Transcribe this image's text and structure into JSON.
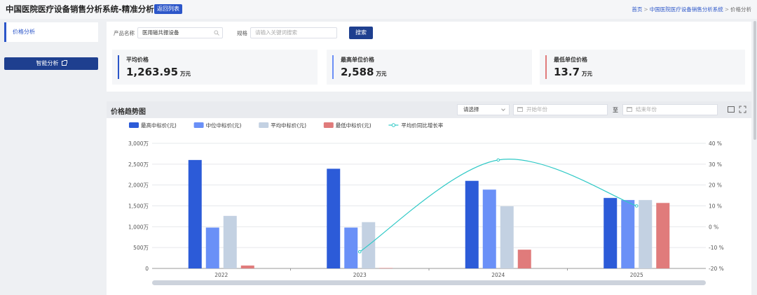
{
  "header": {
    "title": "中国医院医疗设备销售分析系统-精准分析",
    "back_label": "返回列表",
    "breadcrumb": [
      "首页",
      "中国医院医疗设备销售分析系统",
      "价格分析"
    ]
  },
  "sidebar": {
    "items": [
      {
        "label": "价格分析"
      }
    ],
    "smart_button": "智能分析"
  },
  "filter": {
    "product_label": "产品名称",
    "product_value": "医用磁共振设备",
    "spec_label": "规格",
    "spec_placeholder": "请输入关键词搜索",
    "search_button": "搜索"
  },
  "stats": [
    {
      "label": "平均价格",
      "value": "1,263.95",
      "unit": "万元",
      "color": "#2c56c9"
    },
    {
      "label": "最高单位价格",
      "value": "2,588",
      "unit": "万元",
      "color": "#6b8ef5"
    },
    {
      "label": "最低单位价格",
      "value": "13.7",
      "unit": "万元",
      "color": "#e07b7b"
    }
  ],
  "chart_panel": {
    "title": "价格趋势图",
    "select_value": "请选择",
    "start_placeholder": "开始年份",
    "to_label": "至",
    "end_placeholder": "结束年份"
  },
  "chart_data": {
    "type": "bar",
    "categories": [
      "2022",
      "2023",
      "2024",
      "2025"
    ],
    "series": [
      {
        "name": "最高中标价(元)",
        "color": "#2c5bd8",
        "values": [
          2600,
          2390,
          2100,
          1690
        ]
      },
      {
        "name": "中位中标价(元)",
        "color": "#6a90f7",
        "values": [
          980,
          980,
          1890,
          1640
        ]
      },
      {
        "name": "平均中标价(元)",
        "color": "#c3d1e2",
        "values": [
          1260,
          1110,
          1490,
          1640
        ]
      },
      {
        "name": "最低中标价(元)",
        "color": "#e07b7b",
        "values": [
          70,
          10,
          450,
          1570
        ]
      }
    ],
    "line_series": {
      "name": "平均价同比增长率",
      "color": "#2fc9c6",
      "values": [
        null,
        -12,
        32,
        10
      ]
    },
    "y_left": {
      "min": 0,
      "max": 3000,
      "ticks": [
        "0",
        "500万",
        "1,000万",
        "1,500万",
        "2,000万",
        "2,500万",
        "3,000万"
      ]
    },
    "y_right": {
      "min": -20,
      "max": 40,
      "ticks": [
        "-20 %",
        "-10 %",
        "0 %",
        "10 %",
        "20 %",
        "30 %",
        "40 %"
      ]
    },
    "grid": true,
    "legend": "top-left"
  }
}
